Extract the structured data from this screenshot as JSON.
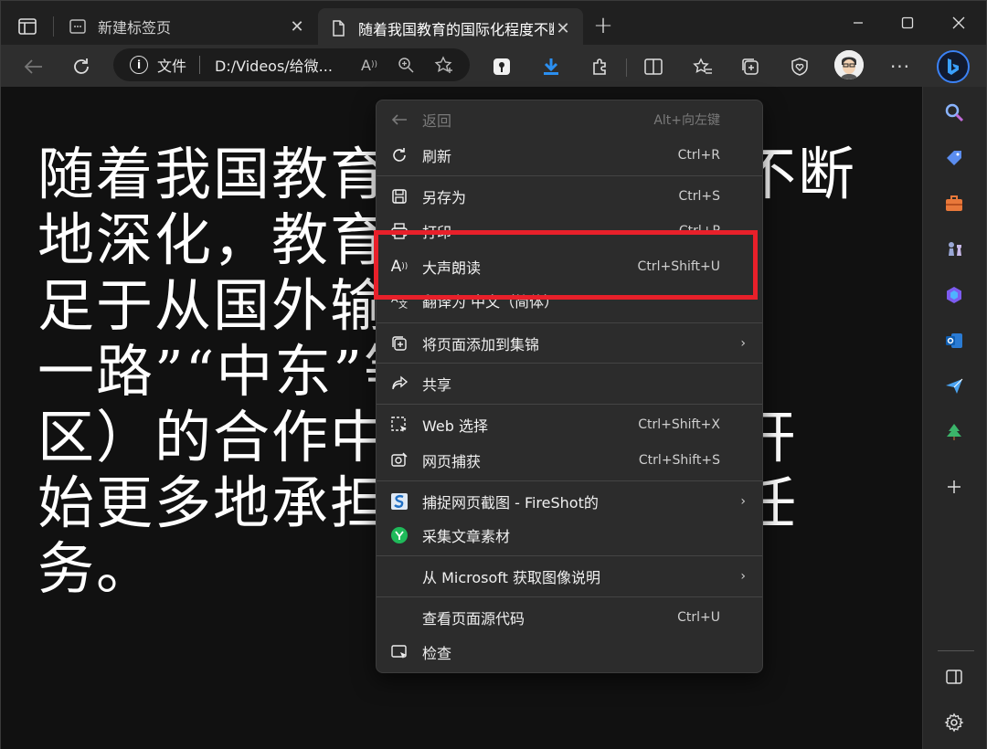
{
  "tabs": {
    "inactive_title": "新建标签页",
    "active_title": "随着我国教育的国际化程度不断地"
  },
  "addressbar": {
    "info_label": "文件",
    "url": "D:/Videos/给微..."
  },
  "article": {
    "lines": [
      "随着我国教育的国际化程度不断",
      "地深化，教育已不再仅仅满",
      "足于从国外输入，在“一带",
      "一路”“中东”等国家和地",
      "区）的合作中，中国教育也开",
      "始更多地承担起对外输出的任",
      "务。"
    ]
  },
  "context_menu": {
    "items": [
      {
        "label": "返回",
        "shortcut": "Alt+向左键"
      },
      {
        "label": "刷新",
        "shortcut": "Ctrl+R"
      },
      {
        "label": "另存为",
        "shortcut": "Ctrl+S"
      },
      {
        "label": "打印",
        "shortcut": "Ctrl+P"
      },
      {
        "label": "大声朗读",
        "shortcut": "Ctrl+Shift+U"
      },
      {
        "label": "翻译为 中文（简体）",
        "shortcut": ""
      },
      {
        "label": "将页面添加到集锦",
        "shortcut": ""
      },
      {
        "label": "共享",
        "shortcut": ""
      },
      {
        "label": "Web 选择",
        "shortcut": "Ctrl+Shift+X"
      },
      {
        "label": "网页捕获",
        "shortcut": "Ctrl+Shift+S"
      },
      {
        "label": "捕捉网页截图 - FireShot的",
        "shortcut": ""
      },
      {
        "label": "采集文章素材",
        "shortcut": ""
      },
      {
        "label": "从 Microsoft 获取图像说明",
        "shortcut": ""
      },
      {
        "label": "查看页面源代码",
        "shortcut": "Ctrl+U"
      },
      {
        "label": "检查",
        "shortcut": ""
      }
    ]
  },
  "colors": {
    "highlight_border": "#e8202a",
    "bing_accent": "#3b82f6"
  }
}
